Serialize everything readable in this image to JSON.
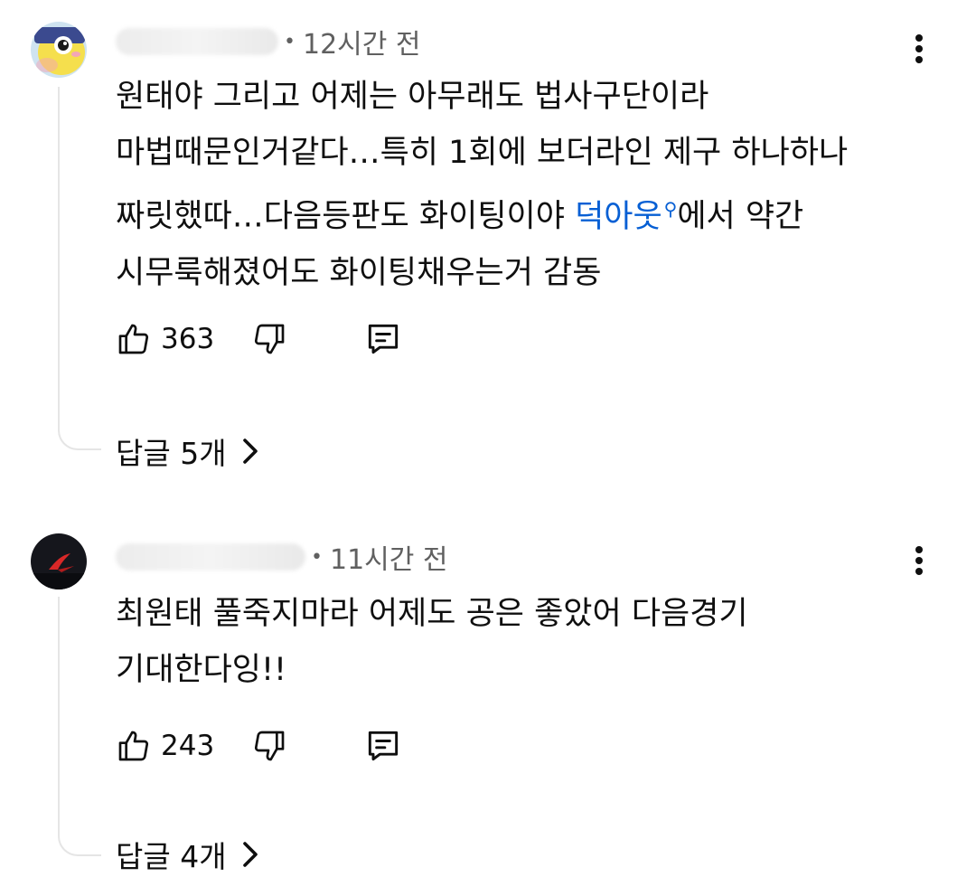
{
  "comments": [
    {
      "time": "12시간 전",
      "text_lines": [
        "원태야 그리고 어제는 아무래도 법사구단이라",
        "마법때문인거같다…특히 1회에 보더라인 제구 하나하나"
      ],
      "line3_before": "짜릿했따…다음등판도 화이팅이야 ",
      "hashtag": "덕아웃",
      "line3_after": "에서 약간",
      "line4": "시무룩해졌어도 화이팅채우는거 감동",
      "likes": "363",
      "replies_label": "답글 5개"
    },
    {
      "time": "11시간 전",
      "text_lines": [
        "최원태 풀죽지마라 어제도 공은 좋았어 다음경기",
        "기대한다잉!!"
      ],
      "likes": "243",
      "replies_label": "답글 4개"
    }
  ],
  "icons": {
    "like": "thumbs-up-icon",
    "dislike": "thumbs-down-icon",
    "reply": "comment-icon",
    "more": "more-vert-icon",
    "chevron": "chevron-right-icon",
    "search": "search-icon"
  },
  "colors": {
    "link": "#065fd4",
    "meta": "#606060",
    "text": "#0f0f0f",
    "thread": "#e5e5e5"
  }
}
